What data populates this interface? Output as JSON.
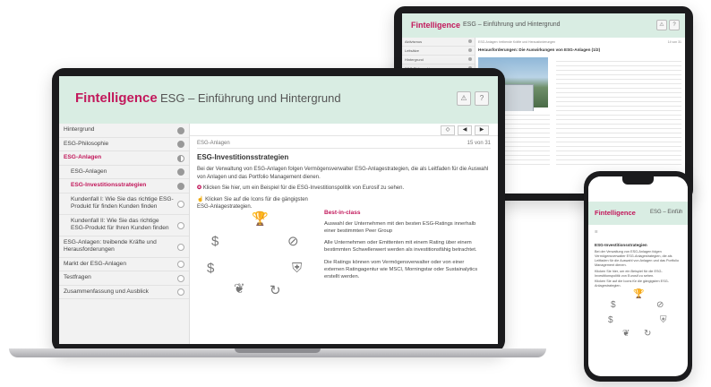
{
  "brand": "Fintelligence",
  "course_title": "ESG – Einführung und Hintergrund",
  "phone_course_title": "ESG – Einfüh",
  "colors": {
    "brand": "#c2185b",
    "header_bg": "#d9ede3"
  },
  "header_buttons": {
    "alert": "⚠",
    "help": "?"
  },
  "toolbar": {
    "expand": "◇",
    "prev": "◀",
    "next": "▶"
  },
  "sidebar": {
    "items": [
      {
        "label": "Hintergrund",
        "status": "done"
      },
      {
        "label": "ESG-Philosophie",
        "status": "done"
      },
      {
        "label": "ESG-Anlagen",
        "status": "half",
        "active": true
      },
      {
        "label": "ESG-Anlagen",
        "status": "done",
        "sub": true
      },
      {
        "label": "ESG-Investitionsstrategien",
        "status": "done",
        "sub": true,
        "active": true
      },
      {
        "label": "Kundenfall I: Wie Sie das richtige ESG-Produkt für finden Kunden finden",
        "status": "open",
        "sub": true
      },
      {
        "label": "Kundenfall II: Wie Sie das richtige ESG-Produkt für Ihren Kunden finden",
        "status": "open",
        "sub": true
      },
      {
        "label": "ESG-Anlagen: treibende Kräfte und Herausforderungen",
        "status": "open"
      },
      {
        "label": "Markt der ESG-Anlagen",
        "status": "open"
      },
      {
        "label": "Testfragen",
        "status": "open"
      },
      {
        "label": "Zusammenfassung und Ausblick",
        "status": "open"
      }
    ]
  },
  "page": {
    "breadcrumb": "ESG-Anlagen",
    "page_number": "15 von 31",
    "title": "ESG-Investitionsstrategien",
    "intro": "Bei der Verwaltung von ESG-Anlagen folgen Vermögensverwalter ESG-Anlagestrategien, die als Leitfaden für die Auswahl von Anlagen und das Portfolio Management dienen.",
    "note1": "Klicken Sie hier, um ein Beispiel für die ESG-Investitionspolitik von Eurosif zu sehen.",
    "note2": "Klicken Sie auf die Icons für die gängigsten ESG-Anlagestrategien.",
    "detail_title": "Best-in-class",
    "detail_p1": "Auswahl der Unternehmen mit den besten ESG-Ratings innerhalb einer bestimmten Peer Group",
    "detail_p2": "Alle Unternehmen oder Emittenten mit einem Rating über einem bestimmten Schwellenwert werden als investitionsfähig betrachtet.",
    "detail_p3": "Die Ratings können vom Vermögensverwalter oder von einer externen Ratingagentur wie MSCI, Morningstar oder Sustainalytics erstellt werden.",
    "icons": [
      "trophy-icon",
      "money-hand-icon",
      "forbidden-icon",
      "money-plant-icon",
      "shield-check-icon",
      "plant-hand-icon",
      "cycle-icon"
    ]
  },
  "tablet": {
    "sidebar": [
      "Aktivismus",
      "Leitsätze",
      "Hintergrund",
      "ESG-Philosophie"
    ],
    "breadcrumb": "ESG-Anlagen: treibende Kräfte und Herausforderungen",
    "title": "Herausforderungen: Die Auswirkungen von ESG-Anlagen (1/2)",
    "page_number": "14 von 31"
  },
  "phone": {
    "title": "ESG-Investitionsstrategien",
    "intro": "Bei der Verwaltung von ESG-Anlagen folgen Vermögensverwalter ESG-Anlagestrategien, die als Leitfaden für die Auswahl von Anlagen und das Portfolio Management dienen.",
    "note1": "Klicken Sie hier, um ein Beispiel für die ESG-Investitionspolitik von Eurosif zu sehen.",
    "note2": "Klicken Sie auf die Icons für die gängigsten ESG-Anlagestrategien."
  }
}
